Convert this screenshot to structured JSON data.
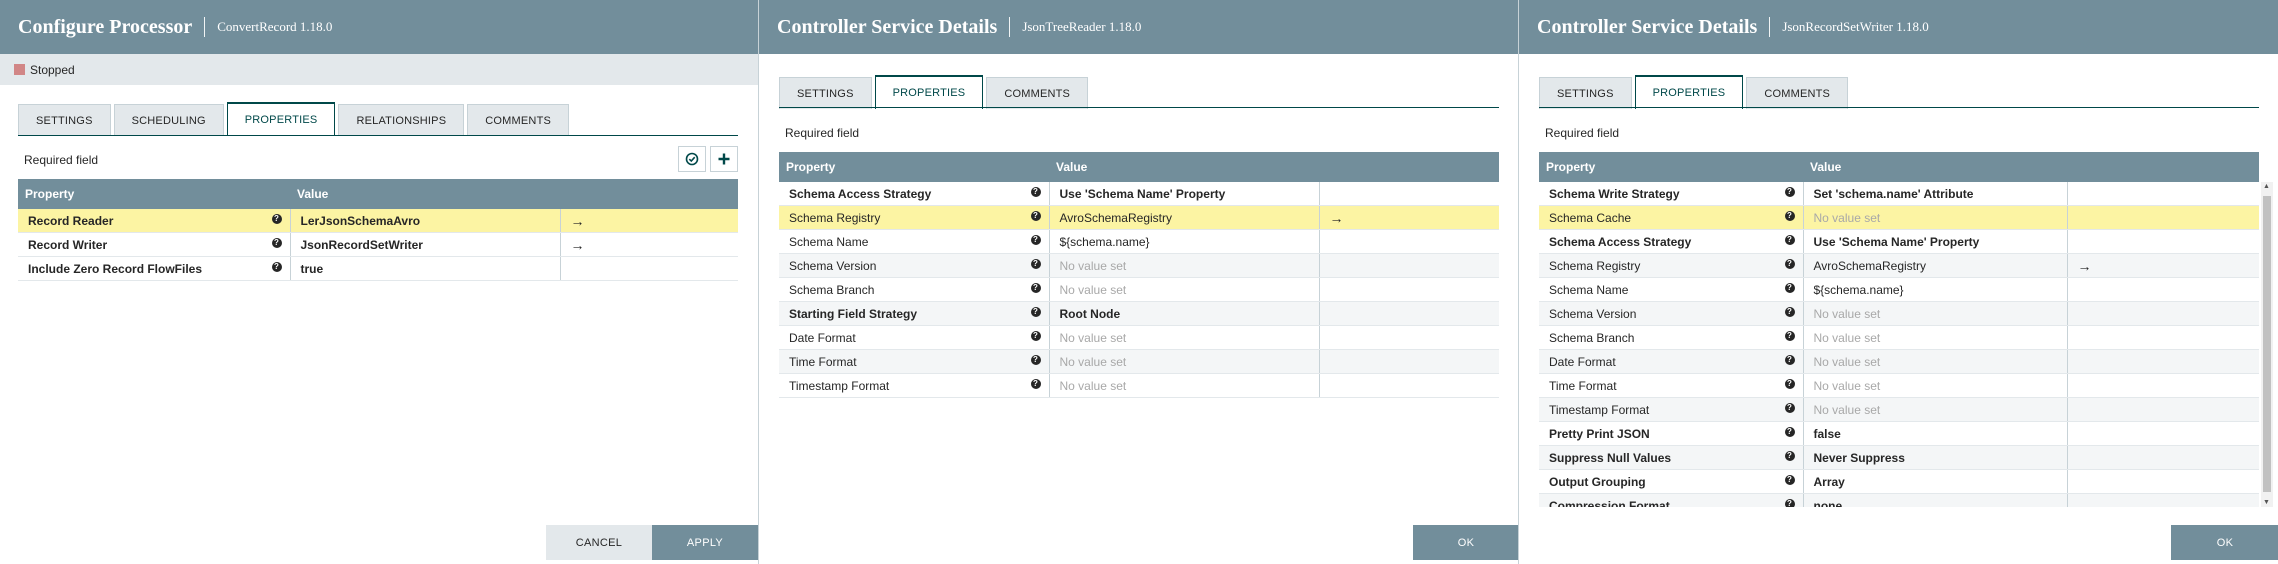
{
  "panel1": {
    "title": "Configure Processor",
    "subtitle": "ConvertRecord 1.18.0",
    "status": "Stopped",
    "tabs": [
      "SETTINGS",
      "SCHEDULING",
      "PROPERTIES",
      "RELATIONSHIPS",
      "COMMENTS"
    ],
    "active_tab": "PROPERTIES",
    "required_field": "Required field",
    "columns": {
      "property": "Property",
      "value": "Value"
    },
    "rows": [
      {
        "name": "Record Reader",
        "value": "LerJsonSchemaAvro",
        "bold": true,
        "selected": true,
        "arrow": "→"
      },
      {
        "name": "Record Writer",
        "value": "JsonRecordSetWriter",
        "bold": true,
        "arrow": "→"
      },
      {
        "name": "Include Zero Record FlowFiles",
        "value": "true",
        "bold": true
      }
    ],
    "cancel": "CANCEL",
    "apply": "APPLY"
  },
  "panel2": {
    "title": "Controller Service Details",
    "subtitle": "JsonTreeReader 1.18.0",
    "tabs": [
      "SETTINGS",
      "PROPERTIES",
      "COMMENTS"
    ],
    "active_tab": "PROPERTIES",
    "required_field": "Required field",
    "columns": {
      "property": "Property",
      "value": "Value"
    },
    "rows": [
      {
        "name": "Schema Access Strategy",
        "value": "Use 'Schema Name' Property",
        "bold": true
      },
      {
        "name": "Schema Registry",
        "value": "AvroSchemaRegistry",
        "selected": true,
        "arrow": "→"
      },
      {
        "name": "Schema Name",
        "value": "${schema.name}"
      },
      {
        "name": "Schema Version",
        "value": "No value set",
        "noval": true
      },
      {
        "name": "Schema Branch",
        "value": "No value set",
        "noval": true
      },
      {
        "name": "Starting Field Strategy",
        "value": "Root Node",
        "bold": true
      },
      {
        "name": "Date Format",
        "value": "No value set",
        "noval": true
      },
      {
        "name": "Time Format",
        "value": "No value set",
        "noval": true
      },
      {
        "name": "Timestamp Format",
        "value": "No value set",
        "noval": true
      }
    ],
    "ok": "OK"
  },
  "panel3": {
    "title": "Controller Service Details",
    "subtitle": "JsonRecordSetWriter 1.18.0",
    "tabs": [
      "SETTINGS",
      "PROPERTIES",
      "COMMENTS"
    ],
    "active_tab": "PROPERTIES",
    "required_field": "Required field",
    "columns": {
      "property": "Property",
      "value": "Value"
    },
    "rows": [
      {
        "name": "Schema Write Strategy",
        "value": "Set 'schema.name' Attribute",
        "bold": true
      },
      {
        "name": "Schema Cache",
        "value": "No value set",
        "noval": true,
        "selected": true
      },
      {
        "name": "Schema Access Strategy",
        "value": "Use 'Schema Name' Property",
        "bold": true
      },
      {
        "name": "Schema Registry",
        "value": "AvroSchemaRegistry",
        "arrow": "→"
      },
      {
        "name": "Schema Name",
        "value": "${schema.name}"
      },
      {
        "name": "Schema Version",
        "value": "No value set",
        "noval": true
      },
      {
        "name": "Schema Branch",
        "value": "No value set",
        "noval": true
      },
      {
        "name": "Date Format",
        "value": "No value set",
        "noval": true
      },
      {
        "name": "Time Format",
        "value": "No value set",
        "noval": true
      },
      {
        "name": "Timestamp Format",
        "value": "No value set",
        "noval": true
      },
      {
        "name": "Pretty Print JSON",
        "value": "false",
        "bold": true
      },
      {
        "name": "Suppress Null Values",
        "value": "Never Suppress",
        "bold": true
      },
      {
        "name": "Output Grouping",
        "value": "Array",
        "bold": true
      },
      {
        "name": "Compression Format",
        "value": "none",
        "bold": true
      }
    ],
    "ok": "OK"
  },
  "icons": {
    "help": "help-circle-icon",
    "arrow": "go-to-arrow-icon",
    "verify": "verify-check-icon",
    "add": "add-plus-icon"
  },
  "colors": {
    "header": "#728e9b",
    "selected_row": "#fcf4a3",
    "tab_accent": "#004849",
    "stopped": "#d18686"
  }
}
